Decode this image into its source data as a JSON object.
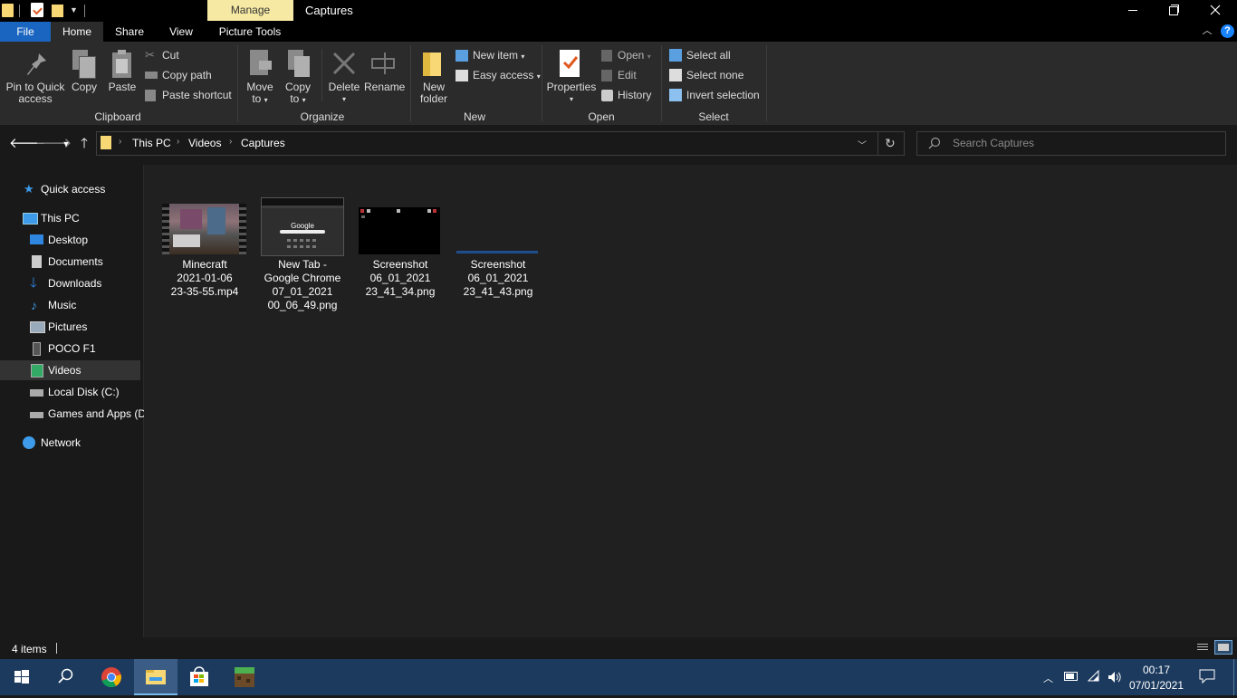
{
  "window": {
    "manage_tab": "Manage",
    "title": "Captures"
  },
  "ribbon_tabs": {
    "file": "File",
    "home": "Home",
    "share": "Share",
    "view": "View",
    "picture_tools": "Picture Tools"
  },
  "ribbon": {
    "clipboard": {
      "group_label": "Clipboard",
      "pin_line1": "Pin to Quick",
      "pin_line2": "access",
      "copy": "Copy",
      "paste": "Paste",
      "cut": "Cut",
      "copy_path": "Copy path",
      "paste_shortcut": "Paste shortcut"
    },
    "organize": {
      "group_label": "Organize",
      "move_to_1": "Move",
      "move_to_2": "to",
      "copy_to_1": "Copy",
      "copy_to_2": "to",
      "delete": "Delete",
      "rename": "Rename"
    },
    "new": {
      "group_label": "New",
      "new_folder_1": "New",
      "new_folder_2": "folder",
      "new_item": "New item",
      "easy_access": "Easy access"
    },
    "open": {
      "group_label": "Open",
      "properties": "Properties",
      "open": "Open",
      "edit": "Edit",
      "history": "History"
    },
    "select": {
      "group_label": "Select",
      "select_all": "Select all",
      "select_none": "Select none",
      "invert_selection": "Invert selection"
    }
  },
  "address": {
    "crumbs": [
      "This PC",
      "Videos",
      "Captures"
    ]
  },
  "search": {
    "placeholder": "Search Captures"
  },
  "navpane": {
    "quick_access": "Quick access",
    "this_pc": "This PC",
    "desktop": "Desktop",
    "documents": "Documents",
    "downloads": "Downloads",
    "music": "Music",
    "pictures": "Pictures",
    "poco": "POCO F1",
    "videos": "Videos",
    "local_disk": "Local Disk (C:)",
    "games": "Games and Apps (D",
    "network": "Network"
  },
  "files": [
    {
      "line1": "Minecraft",
      "line2": "2021-01-06",
      "line3": "23-35-55.mp4",
      "line4": ""
    },
    {
      "line1": "New Tab -",
      "line2": "Google Chrome",
      "line3": "07_01_2021",
      "line4": "00_06_49.png"
    },
    {
      "line1": "Screenshot",
      "line2": "06_01_2021",
      "line3": "23_41_34.png",
      "line4": ""
    },
    {
      "line1": "Screenshot",
      "line2": "06_01_2021",
      "line3": "23_41_43.png",
      "line4": ""
    }
  ],
  "thumb_google_text": "Google",
  "status": {
    "items": "4 items"
  },
  "taskbar": {
    "time": "00:17",
    "date": "07/01/2021"
  },
  "colors": {
    "file_tab": "#1a65c0",
    "manage_tab": "#f6e9a4",
    "taskbar": "#1c3a5e"
  }
}
